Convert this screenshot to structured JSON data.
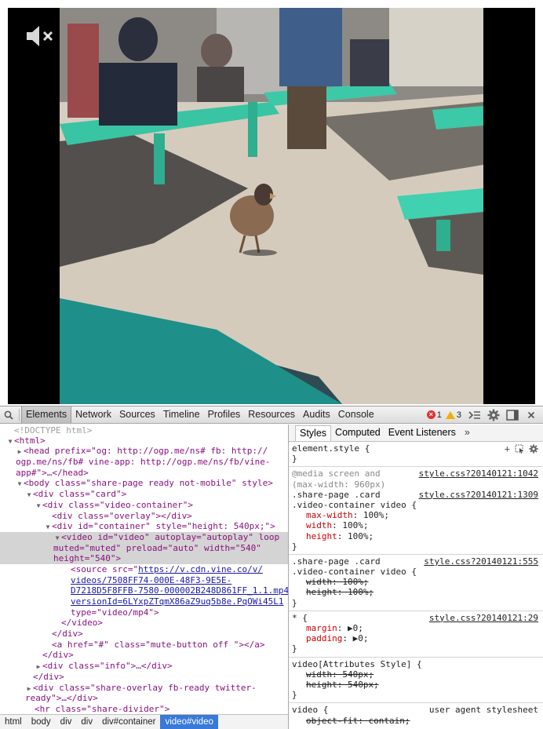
{
  "video": {
    "mute_icon": "speaker-muted-icon"
  },
  "toolbar": {
    "tabs": [
      "Elements",
      "Network",
      "Sources",
      "Timeline",
      "Profiles",
      "Resources",
      "Audits",
      "Console"
    ],
    "error_count": "1",
    "warning_count": "3"
  },
  "elements": {
    "doctype": "<!DOCTYPE html>",
    "html_open": "<html>",
    "head_a": "<head prefix=\"og: http://ogp.me/ns# fb: http://",
    "head_b": "ogp.me/ns/fb# vine-app: http://ogp.me/ns/fb/vine-",
    "head_c": "app#\">…</head>",
    "body": "<body class=\"share-page ready not-mobile\" style>",
    "div_card": "<div class=\"card\">",
    "div_video_container": "<div class=\"video-container\">",
    "div_overlay": "<div class=\"overlay\"></div>",
    "div_container": "<div id=\"container\" style=\"height: 540px;\">",
    "video_a": "<video id=\"video\" autoplay=\"autoplay\" loop",
    "video_b": "muted=\"muted\" preload=\"auto\" width=\"540\"",
    "video_c": "height=\"540\">",
    "source_a": "<source src=\"",
    "source_url_1": "https://v.cdn.vine.co/v/",
    "source_url_2": "videos/7508FF74-000E-48F3-9E5E-",
    "source_url_3": "D7218D5F8FFB-7580-000002B248D861FF_1.1.mp4?",
    "source_url_4": "versionId=6LYxpZTqmX86aZ9uq5b8e.PqOWi45L1",
    "source_type": "type=\"video/mp4\">",
    "video_close": "</video>",
    "div_close_1": "</div>",
    "a_mute": "<a href=\"#\" class=\"mute-button  off \"></a>",
    "div_close_2": "</div>",
    "div_info": "<div class=\"info\">…</div>",
    "div_close_3": "</div>",
    "div_share_overlay_a": "<div class=\"share-overlay fb-ready twitter-",
    "div_share_overlay_b": "ready\">…</div>",
    "hr_divider": "<hr class=\"share-divider\">"
  },
  "breadcrumbs": [
    "html",
    "body",
    "div",
    "div",
    "div#container",
    "video#video"
  ],
  "styles": {
    "tabs": [
      "Styles",
      "Computed",
      "Event Listeners"
    ],
    "more": "»",
    "element_style_open": "element.style {",
    "close": "}",
    "media_1": "@media screen and",
    "media_2": "(max-width: 960px)",
    "r1_src": "style.css?20140121:1042",
    "r1_sel_1": ".share-page .card",
    "r1_src_2": "style.css?20140121:1309",
    "r1_sel_2": ".video-container video {",
    "r1_p1_name": "max-width",
    "r1_p1_val": ": 100%;",
    "r1_p2_name": "width",
    "r1_p2_val": ": 100%;",
    "r1_p3_name": "height",
    "r1_p3_val": ": 100%;",
    "r2_sel_1": ".share-page .card",
    "r2_src": "style.css?20140121:555",
    "r2_sel_2": ".video-container video {",
    "r2_p1": "width: 100%;",
    "r2_p2": "height: 100%;",
    "r3_sel": "* {",
    "r3_src": "style.css?20140121:29",
    "r3_p1_name": "margin",
    "r3_p1_val": ": ▶0;",
    "r3_p2_name": "padding",
    "r3_p2_val": ": ▶0;",
    "r4_sel": "video[Attributes Style] {",
    "r4_p1": "width: 540px;",
    "r4_p2": "height: 540px;",
    "r5_sel": "video {",
    "r5_src": "user agent stylesheet",
    "r5_p1": "object-fit: contain;"
  }
}
